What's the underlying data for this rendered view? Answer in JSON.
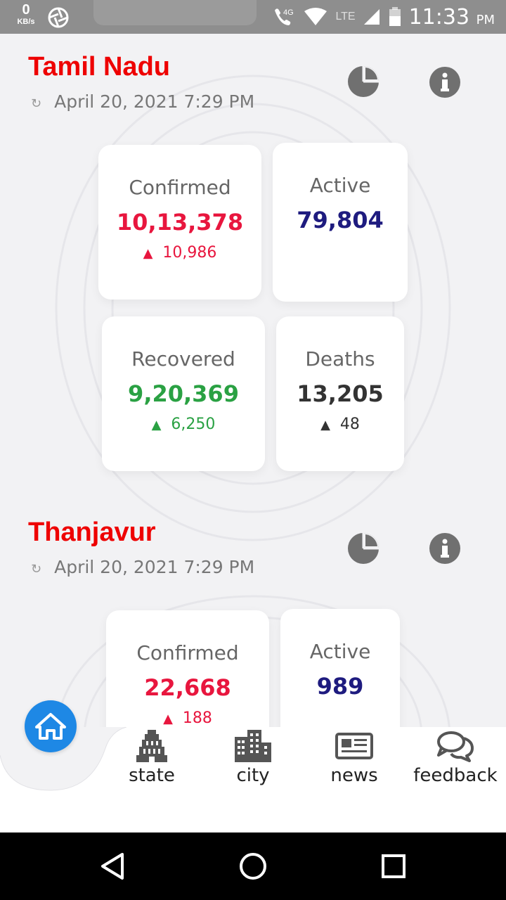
{
  "status_bar": {
    "net_speed": "0",
    "net_unit": "KB/s",
    "network": "4G",
    "lte": "LTE",
    "time": "11:33",
    "ampm": "PM"
  },
  "state": {
    "name": "Tamil Nadu",
    "updated": "April 20, 2021 7:29 PM",
    "refresh_symbol": "↻",
    "confirmed": {
      "label": "Confirmed",
      "value": "10,13,378",
      "delta": "10,986"
    },
    "active": {
      "label": "Active",
      "value": "79,804"
    },
    "recovered": {
      "label": "Recovered",
      "value": "9,20,369",
      "delta": "6,250"
    },
    "deaths": {
      "label": "Deaths",
      "value": "13,205",
      "delta": "48"
    }
  },
  "district": {
    "name": "Thanjavur",
    "updated": "April 20, 2021 7:29 PM",
    "refresh_symbol": "↻",
    "confirmed": {
      "label": "Confirmed",
      "value": "22,668",
      "delta": "188"
    },
    "active": {
      "label": "Active",
      "value": "989"
    }
  },
  "delta_arrow": "▲",
  "nav": {
    "state": "state",
    "city": "city",
    "news": "news",
    "feedback": "feedback"
  },
  "icons": [
    "pie-chart-icon",
    "info-icon",
    "home-icon",
    "temple-icon",
    "city-icon",
    "newspaper-icon",
    "chat-icon",
    "back-icon",
    "home-circle-icon",
    "recents-icon"
  ],
  "colors": {
    "title": "#ee0000",
    "confirmed": "#e8163e",
    "active": "#1e1b7f",
    "recovered": "#2aa143",
    "deaths": "#333333",
    "accent": "#1e88e5"
  }
}
